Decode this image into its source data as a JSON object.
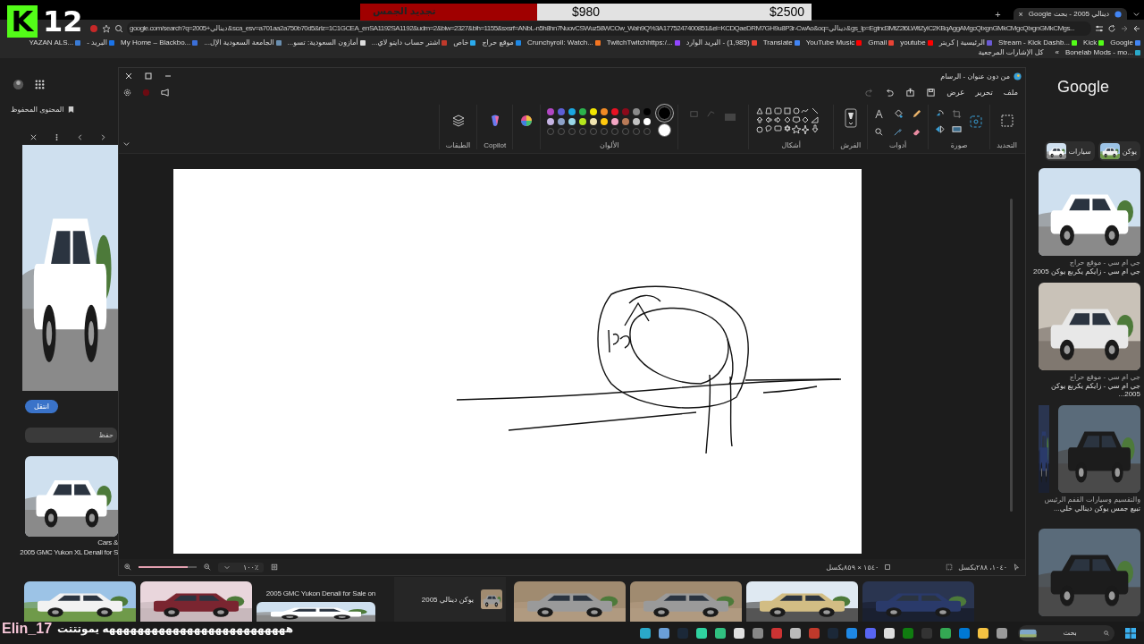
{
  "stream": {
    "logo": "K",
    "counter": "12"
  },
  "goal": {
    "label": "تجديد الجمس",
    "current": "$980",
    "target": "$2500",
    "level": 0.392
  },
  "browser": {
    "tab_title": "دينالي 2005 - بحث Google",
    "new_tab": "+",
    "close_tab": "×",
    "url": "google.com/search?q=2005+دينالي&sca_esv=a701aa2a750b70d5&rlz=1C1GCEA_enSA1192SA1192&udm=2&biw=2327&bih=1155&sxsrf=ANbL-n5h8hn7NuovCSWuz58WCOw_Wah9Q%3A1775247400851&ei=KCDQaeDRM7GH9u8P3r-CwAo&oq=دينالي&gs_lp=Egtnd3MtZ2l6LWltZyIC2KBqAggAMgcQIxgnGMkCMgcQIxgnGMkCMgs...",
    "bookmarks_folder": "كل الإشارات المرجعية",
    "more": "»",
    "bookmarks": [
      {
        "label": "Google",
        "color": "#4285f4"
      },
      {
        "label": "Kick",
        "color": "#53fc18"
      },
      {
        "label": "Stream - Kick Dashb...",
        "color": "#53fc18"
      },
      {
        "label": "الرئيسية | كريتر",
        "color": "#6b5bd6"
      },
      {
        "label": "youtube",
        "color": "#ff0000"
      },
      {
        "label": "Gmail",
        "color": "#ea4335"
      },
      {
        "label": "YouTube Music",
        "color": "#ff0000"
      },
      {
        "label": "Translate",
        "color": "#4285f4"
      },
      {
        "label": "(1,985) - البريد الوارد",
        "color": "#ea4335"
      },
      {
        "label": "TwitchTwitchhttps:/...",
        "color": "#9146ff"
      },
      {
        "label": "Crunchyroll: Watch...",
        "color": "#f47521"
      },
      {
        "label": "موقع حراج",
        "color": "#1e88e5"
      },
      {
        "label": "خاص",
        "color": "#2aabee"
      },
      {
        "label": "اشتر حساب دايتو لاي...",
        "color": "#c0392b"
      },
      {
        "label": "أمازون السعودية: تسو...",
        "color": "#dddddd"
      },
      {
        "label": "الجامعة السعودية الإل...",
        "color": "#6a8fb0"
      },
      {
        "label": "My Home – Blackbo...",
        "color": "#3b6fd8"
      },
      {
        "label": "البريد -",
        "color": "#1a73e8"
      },
      {
        "label": "YAZAN ALS...",
        "color": "#3a7bd5"
      },
      {
        "label": "Bonelab Mods - mo...",
        "color": "#2aa8c9"
      }
    ]
  },
  "google": {
    "logo": "Google",
    "saved_label": "المحتوى المحفوظ",
    "visit_button": "انتقل",
    "save_field": "حفظ",
    "left_captions": [
      "Cars &",
      "2005 GMC Yukon XL Denali for S"
    ],
    "chips": [
      "يوكن",
      "سيارات"
    ],
    "right_results": [
      {
        "source": "جي ام سي - موقع حراج",
        "title": "جي ام سي - زايكم يكربع يوكن 2005"
      },
      {
        "source": "جي ام سي - موقع حراج",
        "title": "جي ام سي - زايكم يكربع يوكن 2005..."
      },
      {
        "source": "والتقسيم وسيارات القفم الرئيس",
        "title": "تبيع جمس يوكن دينالي خلي..."
      }
    ],
    "bottom_caption": "2005 GMC Yukon Denali for Sale on",
    "related": "يوكن دينالي 2005"
  },
  "paint": {
    "title": "من دون عنوان - الرسام",
    "menu": [
      "ملف",
      "تحرير",
      "عرض"
    ],
    "groups": [
      "التحديد",
      "صورة",
      "أدوات",
      "الفرش",
      "أشكال",
      "الألوان",
      "Copilot",
      "الطبقات"
    ],
    "palette": [
      {
        "color": "#b146c2"
      },
      {
        "color": "#5d5fd6"
      },
      {
        "color": "#1aa7e0"
      },
      {
        "color": "#2bb24c"
      },
      {
        "color": "#f2e600"
      },
      {
        "color": "#f08a24"
      },
      {
        "color": "#e81123"
      },
      {
        "color": "#8b0a1a"
      },
      {
        "color": "#8a8a8a"
      },
      {
        "color": "#000000"
      },
      {
        "color": "#c6b4e3"
      },
      {
        "color": "#8da2c8"
      },
      {
        "color": "#9ad7e8"
      },
      {
        "color": "#b5e61d"
      },
      {
        "color": "#efe4b0"
      },
      {
        "color": "#ffc90e"
      },
      {
        "color": "#f4a6c4"
      },
      {
        "color": "#b97a57"
      },
      {
        "color": "#c3c3c3"
      },
      {
        "color": "#ffffff"
      }
    ],
    "current_colors": [
      {
        "color": "#000000",
        "selected": true
      },
      {
        "color": "#ffffff",
        "selected": false
      }
    ],
    "status": {
      "cursor": "١٠٤٠، ٢٨٨بكسل",
      "size": "١٥٤٠ × ٨٥٩بكسل"
    },
    "zoom": {
      "reading": "١٠٠٪",
      "level": 0.85
    }
  },
  "chat": {
    "user": "Elin_17",
    "message": "ههههههههههههههههههههههههههه يموتتتت"
  },
  "taskbar": {
    "search": "بحث"
  }
}
